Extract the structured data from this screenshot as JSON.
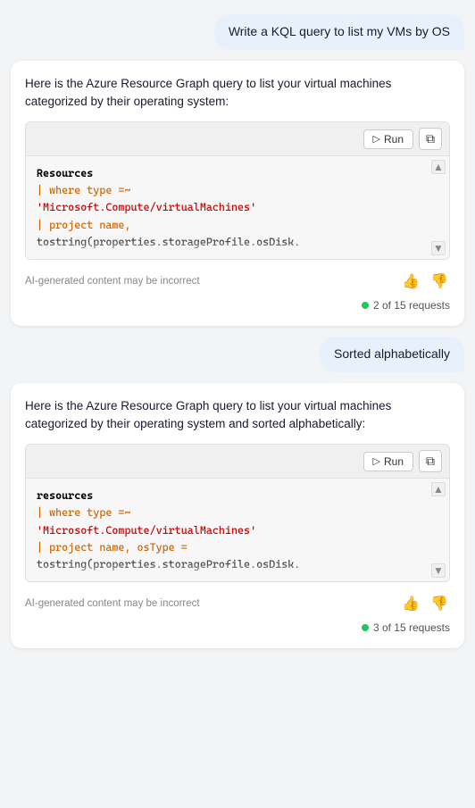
{
  "messages": [
    {
      "type": "user",
      "text": "Write a KQL query to list my VMs by OS"
    },
    {
      "type": "ai",
      "intro": "Here is the Azure Resource Graph query to list your virtual machines categorized by their operating system:",
      "code": [
        {
          "type": "resource",
          "text": "Resources"
        },
        {
          "type": "pipe-kw",
          "text": "| where type =~"
        },
        {
          "type": "string",
          "text": "'Microsoft.Compute/virtualMachines'"
        },
        {
          "type": "pipe-kw",
          "text": "| project name,"
        },
        {
          "type": "plain",
          "text": "tostring(properties.storageProfile.osDisk."
        }
      ],
      "disclaimer": "AI-generated content may be incorrect",
      "run_label": "Run",
      "copy_label": "⧉",
      "requests": "2 of 15 requests"
    }
  ],
  "messages2": [
    {
      "type": "user",
      "text": "Sorted alphabetically"
    },
    {
      "type": "ai",
      "intro": "Here is the Azure Resource Graph query to list your virtual machines categorized by their operating system and sorted alphabetically:",
      "code": [
        {
          "type": "resource",
          "text": "resources"
        },
        {
          "type": "pipe-kw",
          "text": "| where type =~"
        },
        {
          "type": "string",
          "text": "'Microsoft.Compute/virtualMachines'"
        },
        {
          "type": "pipe-kw",
          "text": "| project name, osType ="
        },
        {
          "type": "plain",
          "text": "tostring(properties.storageProfile.osDisk."
        }
      ],
      "disclaimer": "AI-generated content may be incorrect",
      "run_label": "Run",
      "copy_label": "⧉",
      "requests": "3 of 15 requests"
    }
  ],
  "icons": {
    "thumbup": "👍",
    "thumbdown": "👎",
    "play": "▷",
    "copy": "⧉"
  }
}
